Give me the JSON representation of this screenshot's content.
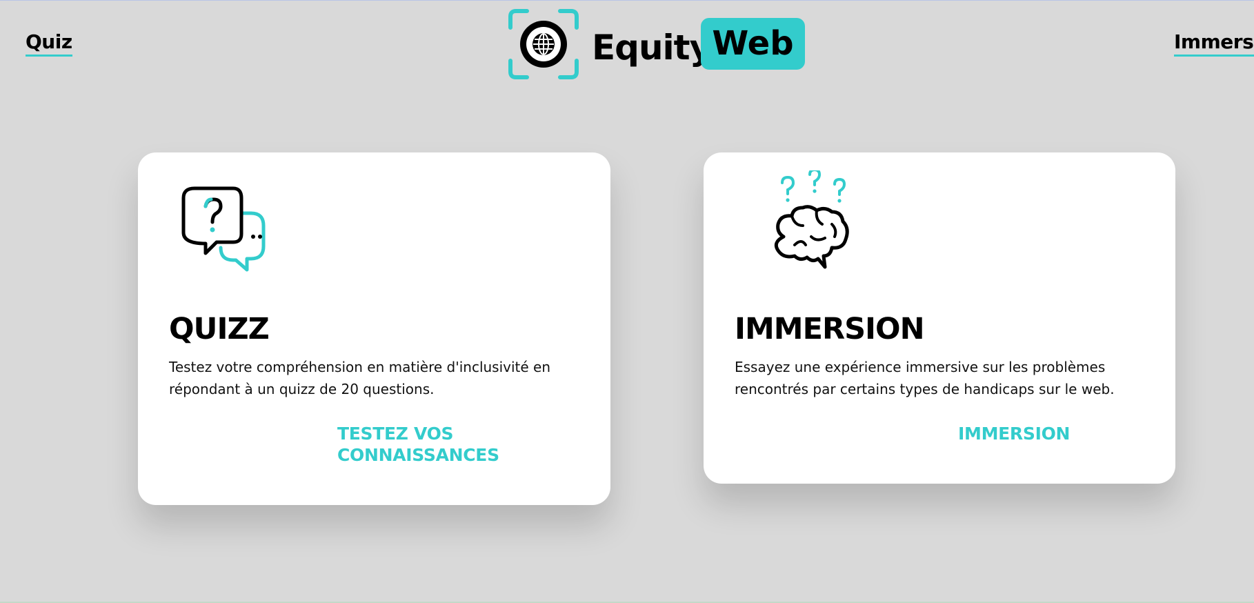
{
  "nav": {
    "left_link": "Quiz",
    "right_link": "Immersion"
  },
  "logo": {
    "word": "Equity",
    "badge": "Web",
    "icon": "globe-scan-icon"
  },
  "cards": [
    {
      "icon": "chat-question-icon",
      "title": "QUIZZ",
      "description": "Testez votre compréhension en matière d'inclusivité en répondant à un quizz de 20 questions.",
      "cta": "TESTEZ VOS CONNAISSANCES"
    },
    {
      "icon": "brain-question-icon",
      "title": "IMMERSION",
      "description": "Essayez une expérience immersive sur les problèmes rencontrés par certains types de handicaps sur le web.",
      "cta": "IMMERSION"
    }
  ],
  "colors": {
    "accent": "#33cccc",
    "background": "#d9d9d9",
    "card": "#ffffff"
  }
}
